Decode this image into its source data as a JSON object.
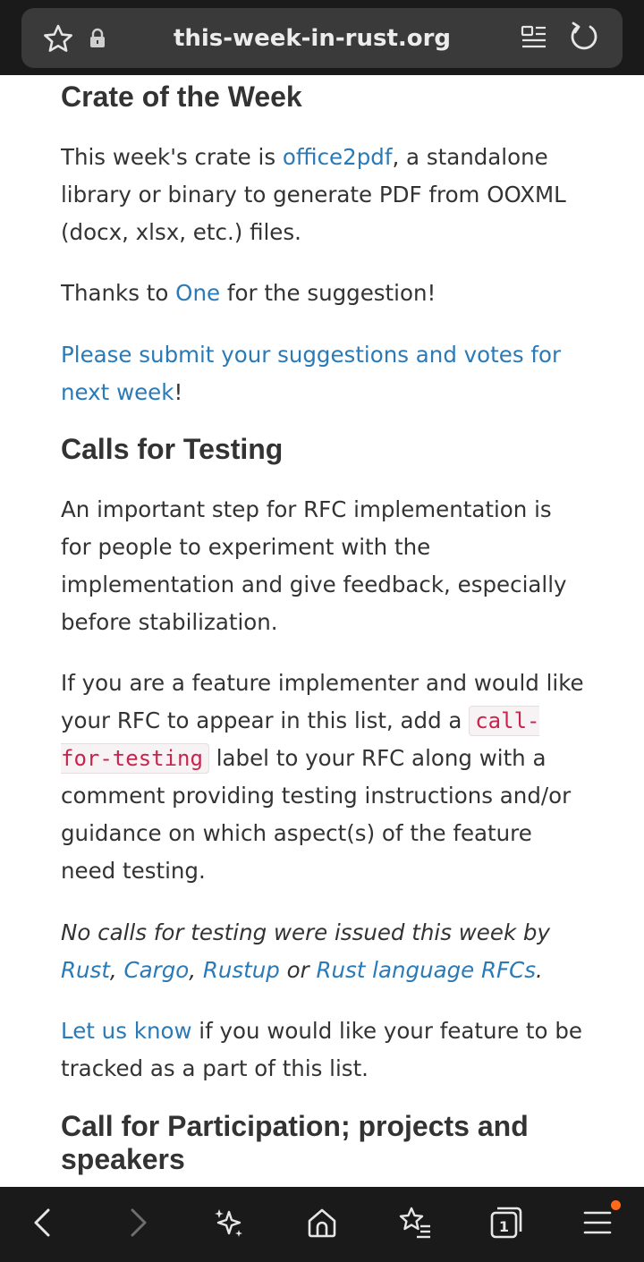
{
  "browser": {
    "url": "this-week-in-rust.org",
    "icons": [
      "star-icon",
      "lock-icon",
      "reader-mode-icon",
      "reload-icon"
    ]
  },
  "crate_section": {
    "heading": "Crate of the Week",
    "p1_before": "This week's crate is ",
    "p1_link": "office2pdf",
    "p1_after": ", a standalone library or binary to generate PDF from OOXML (docx, xlsx, etc.) files.",
    "p2_before": "Thanks to ",
    "p2_link": "One",
    "p2_after": " for the suggestion!",
    "p3_link": "Please submit your suggestions and votes for next week",
    "p3_after": "!"
  },
  "testing_section": {
    "heading": "Calls for Testing",
    "p1": "An important step for RFC implementation is for people to experiment with the implementation and give feedback, especially before stabilization.",
    "p2_before": "If you are a feature implementer and would like your RFC to appear in this list, add a ",
    "p2_code": "call-for-testing",
    "p2_after": " label to your RFC along with a comment providing testing instructions and/or guidance on which aspect(s) of the feature need testing.",
    "p3_before": "No calls for testing were issued this week by ",
    "p3_link1": "Rust",
    "p3_sep1": ", ",
    "p3_link2": "Cargo",
    "p3_sep2": ", ",
    "p3_link3": "Rustup",
    "p3_or": " or ",
    "p3_link4": "Rust language RFCs",
    "p3_end": ".",
    "p4_link": "Let us know",
    "p4_after": " if you would like your feature to be tracked as a part of this list."
  },
  "participation_section": {
    "heading": "Call for Participation; projects and speakers"
  },
  "bottom_nav": {
    "tab_count": "1",
    "icons": [
      "back-icon",
      "forward-icon",
      "ai-sparkle-icon",
      "home-icon",
      "bookmarks-icon",
      "tabs-icon",
      "menu-icon"
    ],
    "notification_color": "#ff6a1a"
  },
  "colors": {
    "link": "#2a7ab8",
    "code": "#c7254e",
    "text": "#333333",
    "chrome": "#1a1a1a"
  }
}
